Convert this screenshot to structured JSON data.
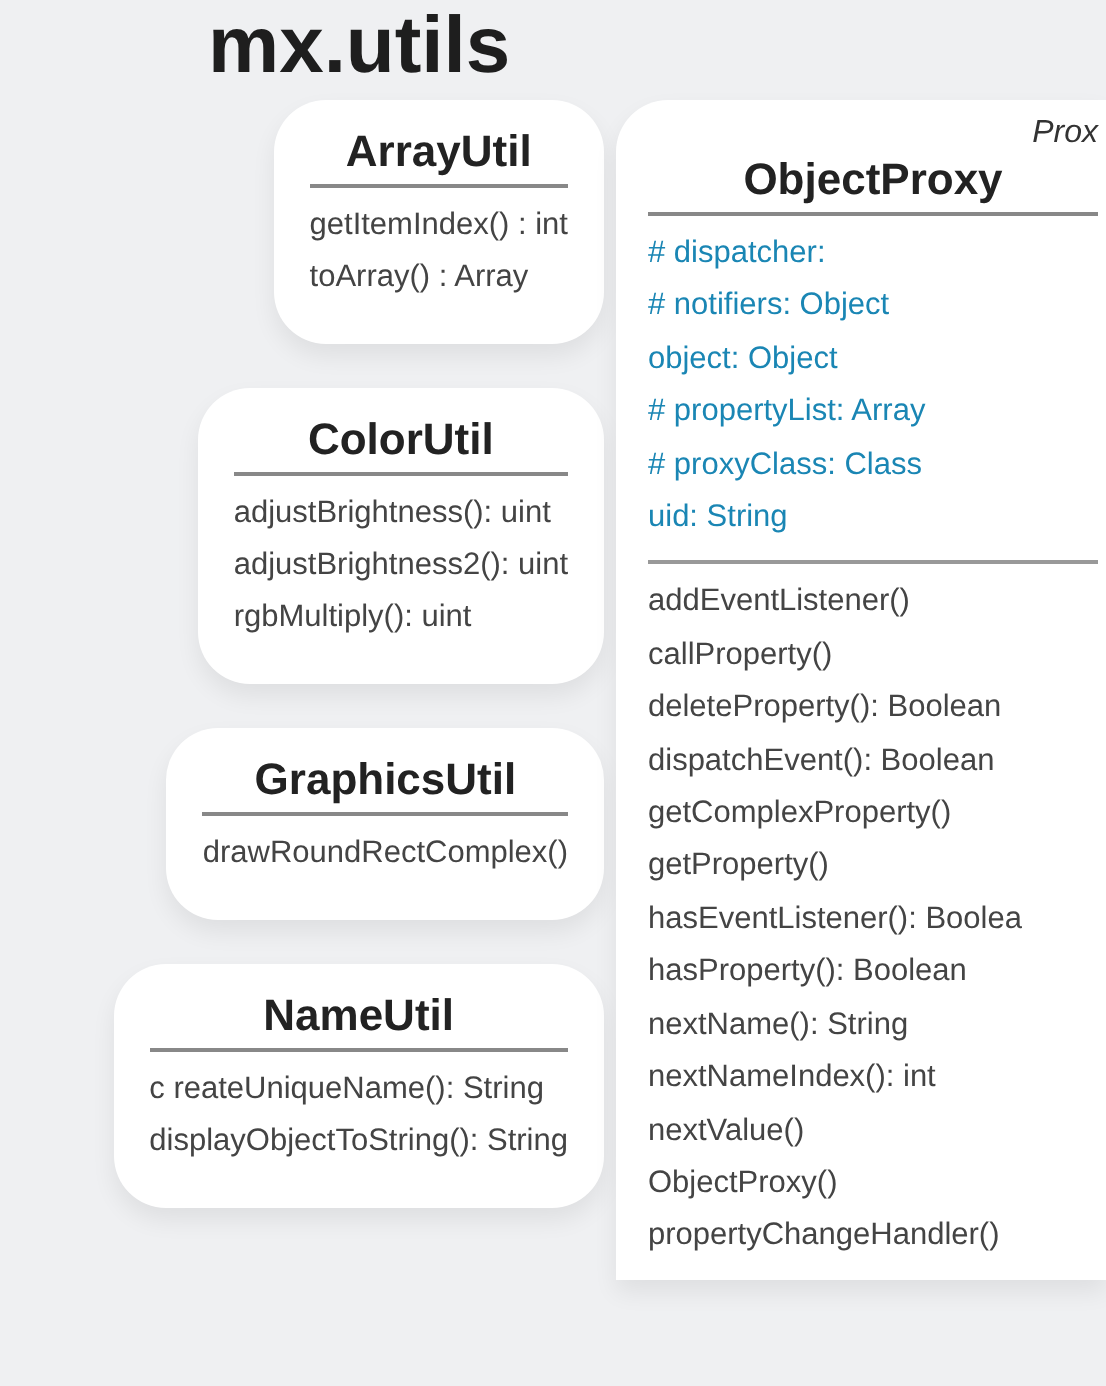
{
  "title": "mx.utils",
  "utility_classes": [
    {
      "name": "ArrayUtil",
      "methods": [
        "getItemIndex() : int",
        "toArray() : Array"
      ]
    },
    {
      "name": "ColorUtil",
      "methods": [
        "adjustBrightness(): uint",
        "adjustBrightness2(): uint",
        "rgbMultiply(): uint"
      ]
    },
    {
      "name": "GraphicsUtil",
      "methods": [
        "drawRoundRectComplex()"
      ]
    },
    {
      "name": "NameUtil",
      "methods": [
        "c reateUniqueName(): String",
        "displayObjectToString(): String"
      ]
    }
  ],
  "main_class": {
    "stereotype": "Prox",
    "name": "ObjectProxy",
    "attributes": [
      "# dispatcher:",
      "# notifiers: Object",
      "object: Object",
      "# propertyList: Array",
      "# proxyClass: Class",
      "uid: String"
    ],
    "methods": [
      "addEventListener()",
      "callProperty()",
      "deleteProperty(): Boolean",
      "dispatchEvent(): Boolean",
      "getComplexProperty()",
      "getProperty()",
      "hasEventListener(): Boolea",
      "hasProperty(): Boolean",
      "nextName(): String",
      "nextNameIndex(): int",
      "nextValue()",
      "ObjectProxy()",
      "propertyChangeHandler()"
    ]
  }
}
